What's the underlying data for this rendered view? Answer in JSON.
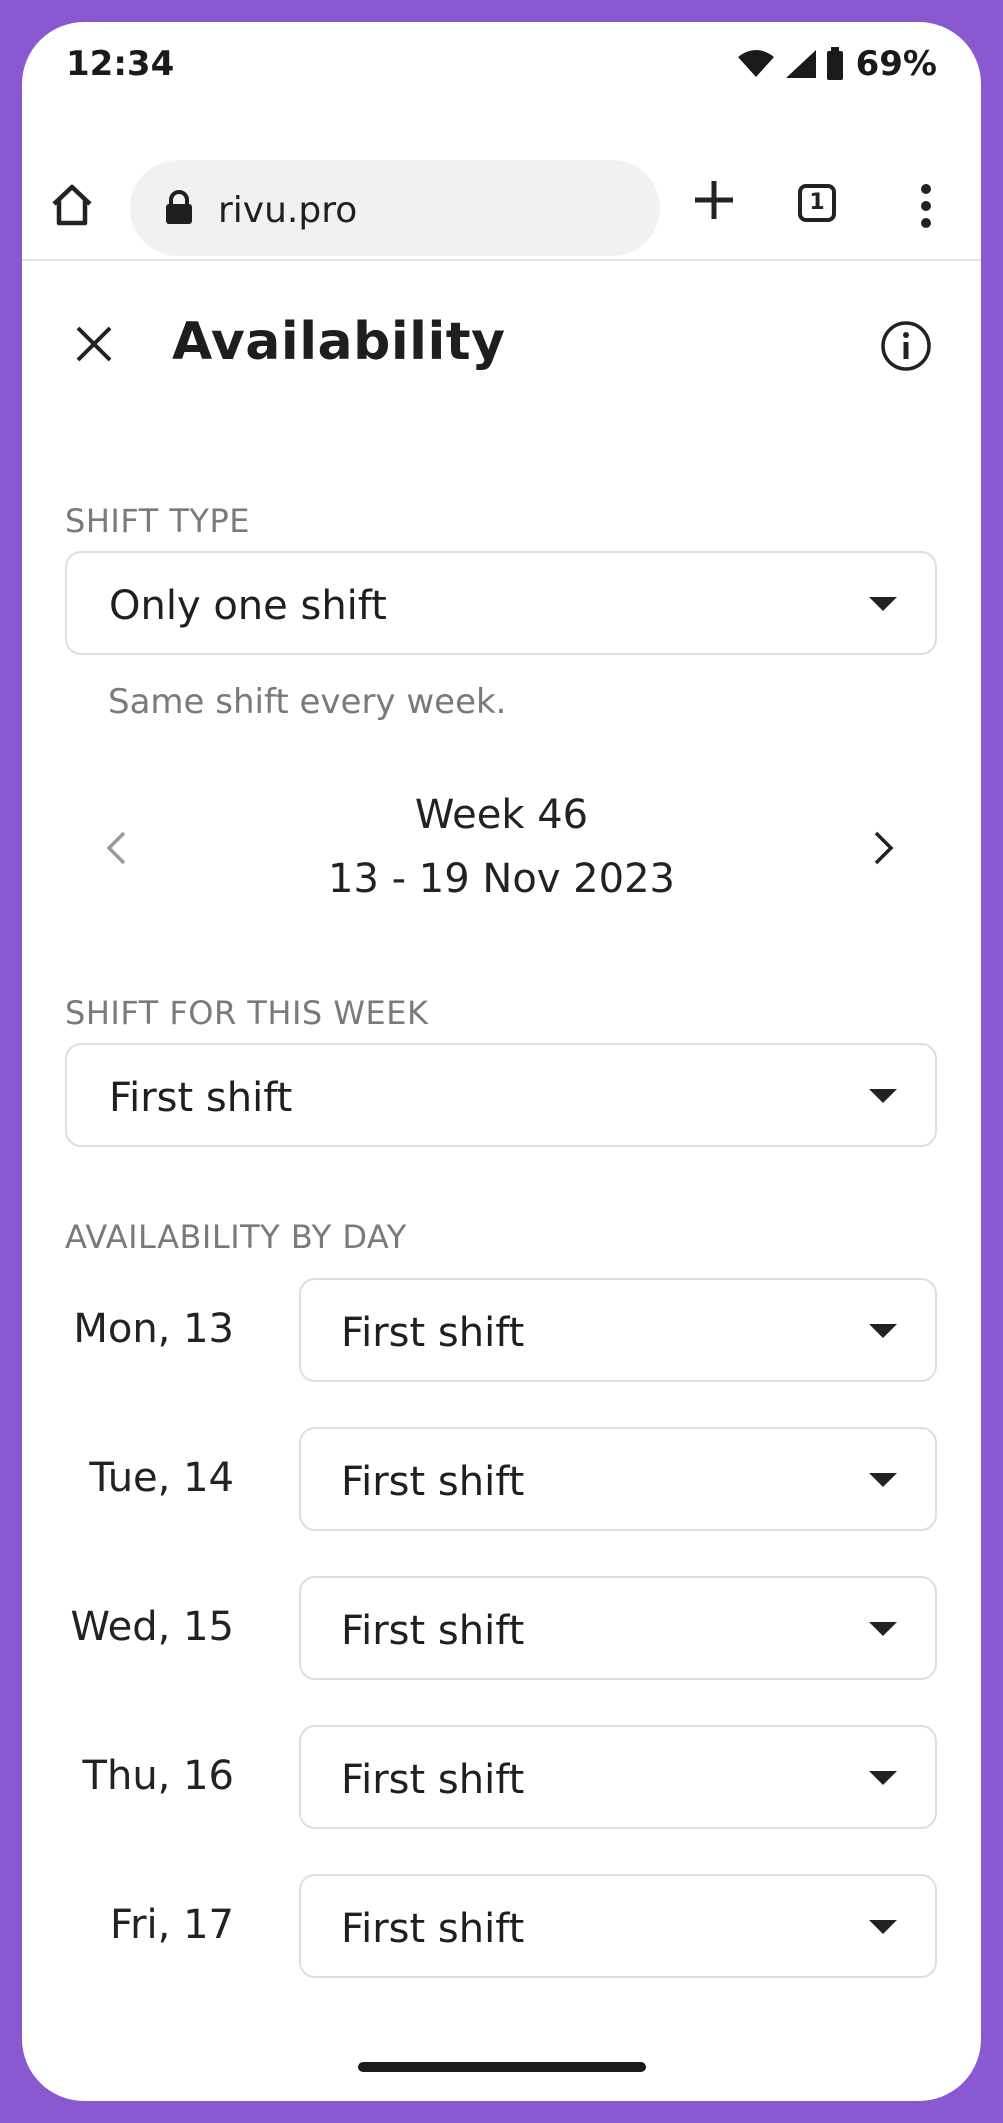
{
  "status_bar": {
    "time": "12:34",
    "battery": "69%"
  },
  "browser": {
    "url": "rivu.pro",
    "tab_count": "1"
  },
  "header": {
    "title": "Availability"
  },
  "shift_type": {
    "label": "SHIFT TYPE",
    "value": "Only one shift",
    "hint": "Same shift every week."
  },
  "week": {
    "title": "Week 46",
    "range": "13 - 19 Nov 2023"
  },
  "shift_for_week": {
    "label": "SHIFT FOR THIS WEEK",
    "value": "First shift"
  },
  "availability": {
    "label": "AVAILABILITY BY DAY",
    "days": [
      {
        "day": "Mon, 13",
        "value": "First shift"
      },
      {
        "day": "Tue, 14",
        "value": "First shift"
      },
      {
        "day": "Wed, 15",
        "value": "First shift"
      },
      {
        "day": "Thu, 16",
        "value": "First shift"
      },
      {
        "day": "Fri, 17",
        "value": "First shift"
      }
    ]
  },
  "colors": {
    "frame": "#8a58d0",
    "border": "#dedede",
    "muted": "#7a7a7a"
  }
}
